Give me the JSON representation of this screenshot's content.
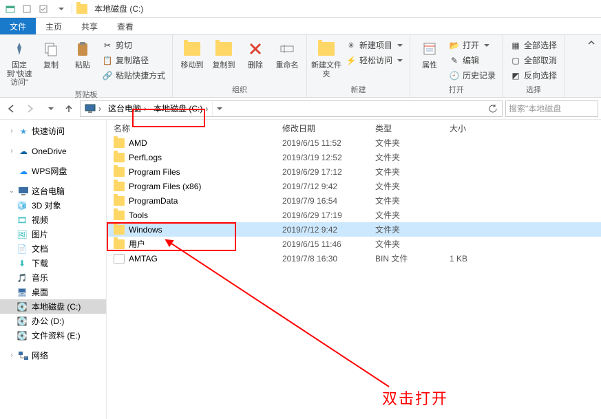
{
  "window": {
    "title": "本地磁盘 (C:)"
  },
  "tabs": {
    "file": "文件",
    "home": "主页",
    "share": "共享",
    "view": "查看"
  },
  "ribbon": {
    "clipboard": {
      "label": "剪贴板",
      "pin": "固定到\"快速访问\"",
      "copy": "复制",
      "paste": "粘贴",
      "cut": "剪切",
      "copy_path": "复制路径",
      "paste_shortcut": "粘贴快捷方式"
    },
    "organize": {
      "label": "组织",
      "move_to": "移动到",
      "copy_to": "复制到",
      "delete": "删除",
      "rename": "重命名"
    },
    "new": {
      "label": "新建",
      "new_folder": "新建文件夹",
      "new_item": "新建项目",
      "easy_access": "轻松访问"
    },
    "open": {
      "label": "打开",
      "properties": "属性",
      "open": "打开",
      "edit": "编辑",
      "history": "历史记录"
    },
    "select": {
      "label": "选择",
      "select_all": "全部选择",
      "select_none": "全部取消",
      "invert": "反向选择"
    }
  },
  "nav": {
    "this_pc": "这台电脑",
    "drive": "本地磁盘 (C:)",
    "search_placeholder": "搜索\"本地磁盘"
  },
  "sidebar": {
    "quick": "快速访问",
    "onedrive": "OneDrive",
    "wps": "WPS网盘",
    "this_pc": "这台电脑",
    "children": [
      {
        "label": "3D 对象"
      },
      {
        "label": "视频"
      },
      {
        "label": "图片"
      },
      {
        "label": "文档"
      },
      {
        "label": "下载"
      },
      {
        "label": "音乐"
      },
      {
        "label": "桌面"
      },
      {
        "label": "本地磁盘 (C:)"
      },
      {
        "label": "办公 (D:)"
      },
      {
        "label": "文件资料 (E:)"
      }
    ],
    "network": "网络"
  },
  "columns": {
    "name": "名称",
    "date": "修改日期",
    "type": "类型",
    "size": "大小"
  },
  "files": [
    {
      "name": "AMD",
      "date": "2019/6/15 11:52",
      "type": "文件夹",
      "size": ""
    },
    {
      "name": "PerfLogs",
      "date": "2019/3/19 12:52",
      "type": "文件夹",
      "size": ""
    },
    {
      "name": "Program Files",
      "date": "2019/6/29 17:12",
      "type": "文件夹",
      "size": ""
    },
    {
      "name": "Program Files (x86)",
      "date": "2019/7/12 9:42",
      "type": "文件夹",
      "size": ""
    },
    {
      "name": "ProgramData",
      "date": "2019/7/9 16:54",
      "type": "文件夹",
      "size": ""
    },
    {
      "name": "Tools",
      "date": "2019/6/29 17:19",
      "type": "文件夹",
      "size": ""
    },
    {
      "name": "Windows",
      "date": "2019/7/12 9:42",
      "type": "文件夹",
      "size": "",
      "selected": true
    },
    {
      "name": "用户",
      "date": "2019/6/15 11:46",
      "type": "文件夹",
      "size": ""
    },
    {
      "name": "AMTAG",
      "date": "2019/7/8 16:30",
      "type": "BIN 文件",
      "size": "1 KB",
      "file": true
    }
  ],
  "annotation": {
    "text": "双击打开"
  }
}
